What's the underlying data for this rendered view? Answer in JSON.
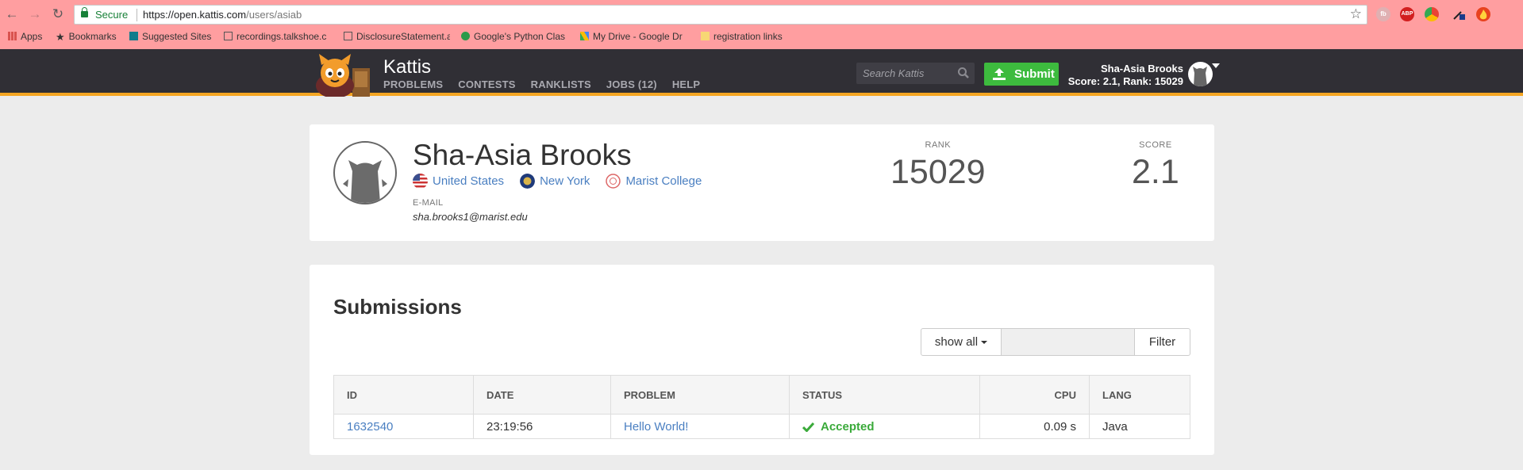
{
  "browser": {
    "secure_label": "Secure",
    "url_host": "https://open.kattis.com",
    "url_path": "/users/asiab",
    "bookmarks": [
      {
        "label": "Apps"
      },
      {
        "label": "Bookmarks"
      },
      {
        "label": "Suggested Sites"
      },
      {
        "label": "recordings.talkshoe.c"
      },
      {
        "label": "DisclosureStatement.a"
      },
      {
        "label": "Google's Python Clas"
      },
      {
        "label": "My Drive - Google Dr"
      },
      {
        "label": "registration links"
      }
    ],
    "extensions": [
      "fb",
      "ABP"
    ]
  },
  "nav": {
    "brand": "Kattis",
    "links": [
      "PROBLEMS",
      "CONTESTS",
      "RANKLISTS",
      "JOBS (12)",
      "HELP"
    ],
    "search_placeholder": "Search Kattis",
    "submit_label": "Submit",
    "user_name": "Sha-Asia Brooks",
    "user_stats": "Score: 2.1, Rank: 15029"
  },
  "profile": {
    "name": "Sha-Asia Brooks",
    "country": "United States",
    "region": "New York",
    "school": "Marist College",
    "email_label": "E-MAIL",
    "email": "sha.brooks1@marist.edu",
    "rank_label": "RANK",
    "rank": "15029",
    "score_label": "SCORE",
    "score": "2.1"
  },
  "submissions": {
    "title": "Submissions",
    "filter_select": "show all",
    "filter_button": "Filter",
    "columns": [
      "ID",
      "DATE",
      "PROBLEM",
      "STATUS",
      "CPU",
      "LANG"
    ],
    "rows": [
      {
        "id": "1632540",
        "date": "23:19:56",
        "problem": "Hello World!",
        "status": "Accepted",
        "cpu": "0.09 s",
        "lang": "Java"
      }
    ]
  },
  "colors": {
    "accent": "#f5a623",
    "nav_bg": "#302f35",
    "submit": "#3dbb3e",
    "link": "#4a7fc1",
    "chrome": "#ff9ea0"
  }
}
